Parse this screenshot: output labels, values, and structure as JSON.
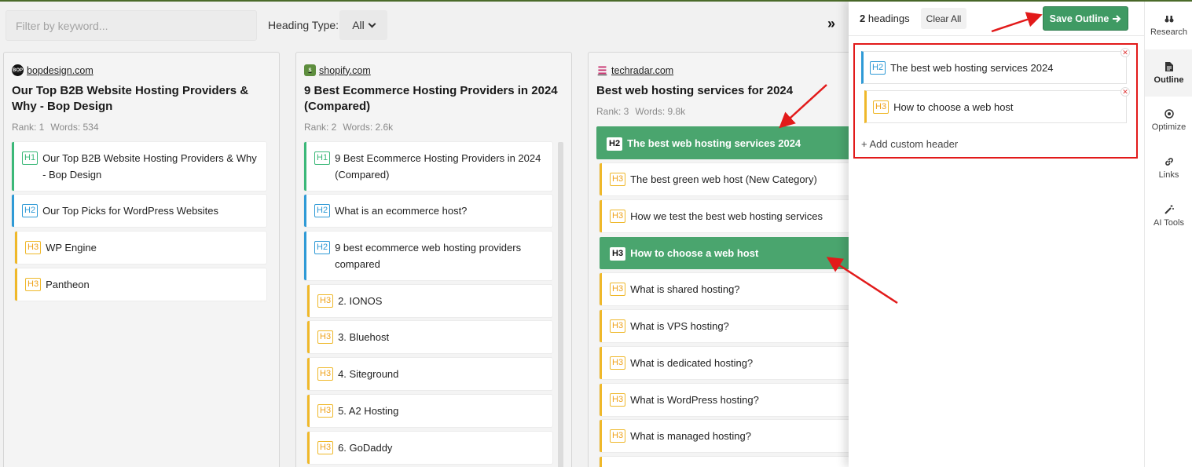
{
  "toolbar": {
    "filter_placeholder": "Filter by keyword...",
    "heading_type_label": "Heading Type:",
    "heading_type_value": "All",
    "expand_glyph": "»"
  },
  "columns": [
    {
      "source": "bopdesign.com",
      "favicon_text": "BOP",
      "title": "Our Top B2B Website Hosting Providers & Why - Bop Design",
      "rank": "Rank: 1",
      "words": "Words: 534",
      "headings": [
        {
          "tag": "H1",
          "text": "Our Top B2B Website Hosting Providers & Why - Bop Design"
        },
        {
          "tag": "H2",
          "text": "Our Top Picks for WordPress Websites"
        },
        {
          "tag": "H3",
          "text": "WP Engine"
        },
        {
          "tag": "H3",
          "text": "Pantheon"
        }
      ]
    },
    {
      "source": "shopify.com",
      "favicon_text": "S",
      "title": "9 Best Ecommerce Hosting Providers in 2024 (Compared)",
      "rank": "Rank: 2",
      "words": "Words: 2.6k",
      "headings": [
        {
          "tag": "H1",
          "text": "9 Best Ecommerce Hosting Providers in 2024 (Compared)"
        },
        {
          "tag": "H2",
          "text": "What is an ecommerce host?"
        },
        {
          "tag": "H2",
          "text": "9 best ecommerce web hosting providers compared"
        },
        {
          "tag": "H3",
          "text": "2. IONOS"
        },
        {
          "tag": "H3",
          "text": "3. Bluehost"
        },
        {
          "tag": "H3",
          "text": "4. Siteground"
        },
        {
          "tag": "H3",
          "text": "5. A2 Hosting"
        },
        {
          "tag": "H3",
          "text": "6. GoDaddy"
        }
      ]
    },
    {
      "source": "techradar.com",
      "favicon_text": "☰",
      "title": "Best web hosting services for 2024",
      "rank": "Rank: 3",
      "words": "Words: 9.8k",
      "headings": [
        {
          "tag": "H2",
          "text": "The best web hosting services 2024",
          "selected": true
        },
        {
          "tag": "H3",
          "text": "The best green web host (New Category)"
        },
        {
          "tag": "H3",
          "text": "How we test the best web hosting services"
        },
        {
          "tag": "H3",
          "text": "How to choose a web host",
          "selected": true
        },
        {
          "tag": "H3",
          "text": "What is shared hosting?"
        },
        {
          "tag": "H3",
          "text": "What is VPS hosting?"
        },
        {
          "tag": "H3",
          "text": "What is dedicated hosting?"
        },
        {
          "tag": "H3",
          "text": "What is WordPress hosting?"
        },
        {
          "tag": "H3",
          "text": "What is managed hosting?"
        }
      ]
    }
  ],
  "panel": {
    "count_number": "2",
    "count_label": "headings",
    "clear_label": "Clear All",
    "save_label": "Save Outline",
    "outline": [
      {
        "tag": "H2",
        "text": "The best web hosting services 2024"
      },
      {
        "tag": "H3",
        "text": "How to choose a web host"
      }
    ],
    "add_custom_label": "+ Add custom header"
  },
  "sidenav": [
    {
      "label": "Research",
      "icon": "binoculars-icon"
    },
    {
      "label": "Outline",
      "icon": "document-icon",
      "active": true
    },
    {
      "label": "Optimize",
      "icon": "target-icon"
    },
    {
      "label": "Links",
      "icon": "link-icon"
    },
    {
      "label": "AI Tools",
      "icon": "magic-wand-icon"
    }
  ],
  "colors": {
    "h1": "#3bb878",
    "h2": "#2f9ad6",
    "h3": "#efb82a",
    "selected": "#4aa56e",
    "save": "#3f9a63",
    "annotation": "#e21a1a"
  }
}
